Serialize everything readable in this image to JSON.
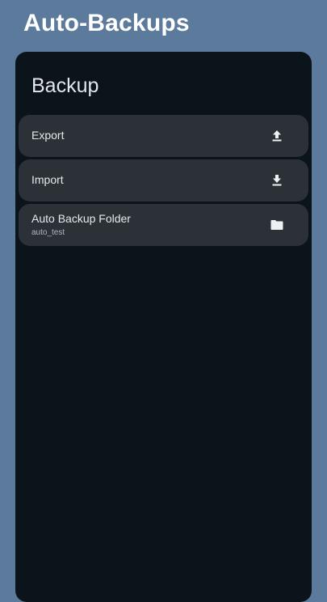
{
  "app": {
    "title": "Auto-Backups"
  },
  "section": {
    "title": "Backup"
  },
  "items": [
    {
      "label": "Export",
      "icon": "upload-icon"
    },
    {
      "label": "Import",
      "icon": "download-icon"
    },
    {
      "label": "Auto Backup Folder",
      "value": "auto_test",
      "icon": "folder-icon"
    }
  ],
  "colors": {
    "background": "#5b7a9c",
    "panel": "#0c141b",
    "row": "#2b3137",
    "text": "#e6e9ec"
  }
}
